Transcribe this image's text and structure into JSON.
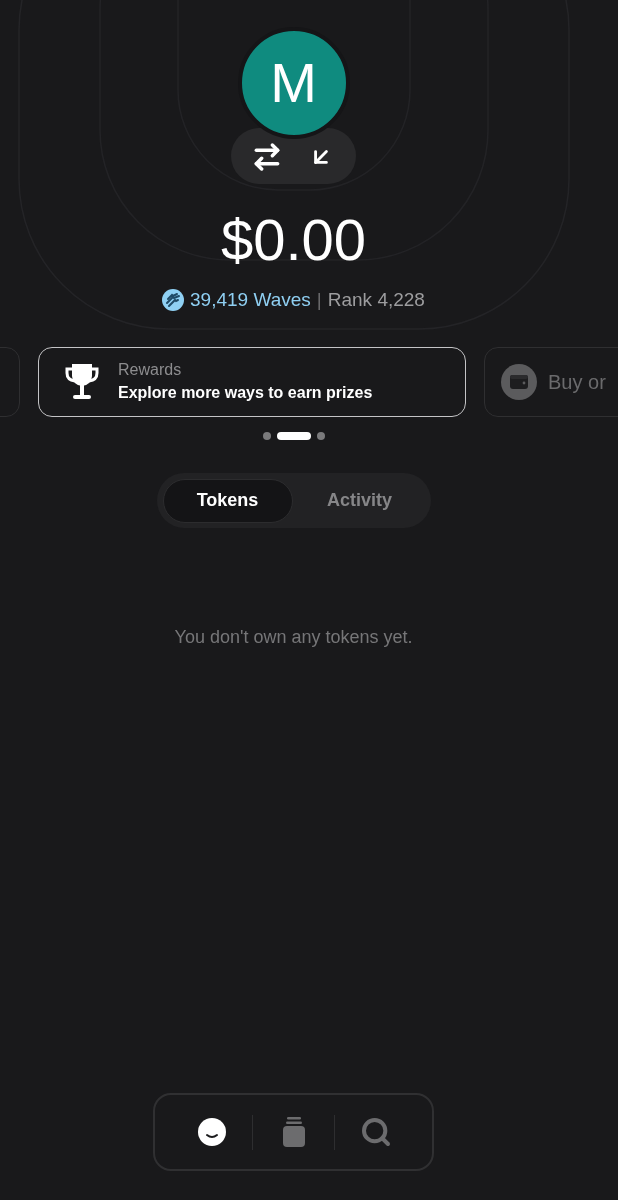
{
  "avatar": {
    "initial": "M"
  },
  "balance": "$0.00",
  "stats": {
    "waves": "39,419 Waves",
    "separator": "|",
    "rank": "Rank 4,228"
  },
  "carousel": {
    "cards": [
      {
        "kind": "blank",
        "selected": false
      },
      {
        "kind": "rewards",
        "label": "Rewards",
        "text": "Explore more ways to earn prizes",
        "selected": true
      },
      {
        "kind": "buy",
        "text": "Buy or",
        "selected": false
      }
    ]
  },
  "tabs": [
    {
      "label": "Tokens",
      "selected": true
    },
    {
      "label": "Activity",
      "selected": false
    }
  ],
  "empty_state": "You don't own any tokens yet.",
  "bottom_nav": [
    {
      "kind": "profile",
      "selected": true
    },
    {
      "kind": "collection",
      "selected": false
    },
    {
      "kind": "search",
      "selected": false
    }
  ]
}
